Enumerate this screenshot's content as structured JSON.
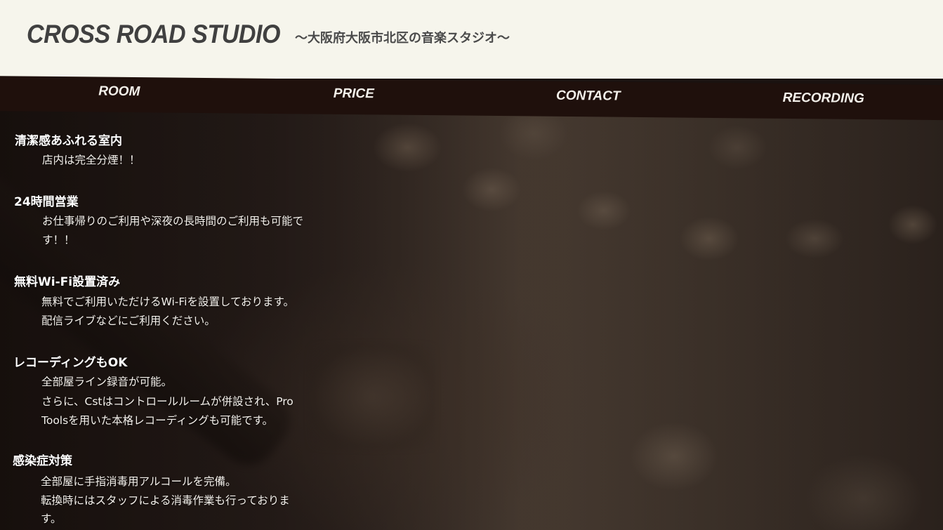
{
  "header": {
    "logo": "CROSS ROAD STUDIO",
    "tagline": "〜大阪府大阪市北区の音楽スタジオ〜"
  },
  "nav": {
    "items": [
      {
        "label": "ROOM"
      },
      {
        "label": "PRICE"
      },
      {
        "label": "CONTACT"
      },
      {
        "label": "RECORDING"
      }
    ]
  },
  "features": [
    {
      "heading": "清潔感あふれる室内",
      "lines": [
        "店内は完全分煙！！"
      ]
    },
    {
      "heading": "24時間営業",
      "lines": [
        "お仕事帰りのご利用や深夜の長時間のご利用も可能で",
        "す！！"
      ]
    },
    {
      "heading": "無料Wi-Fi設置済み",
      "lines": [
        "無料でご利用いただけるWi-Fiを設置しております。",
        "配信ライブなどにご利用ください。"
      ]
    },
    {
      "heading": "レコーディングもOK",
      "lines": [
        "全部屋ライン録音が可能。",
        "さらに、Cstはコントロールルームが併設され、Pro",
        "Toolsを用いた本格レコーディングも可能です。"
      ]
    },
    {
      "heading": "感染症対策",
      "lines": [
        "全部屋に手指消毒用アルコールを完備。",
        "転換時にはスタッフによる消毒作業も行っておりま",
        "す。"
      ]
    }
  ]
}
